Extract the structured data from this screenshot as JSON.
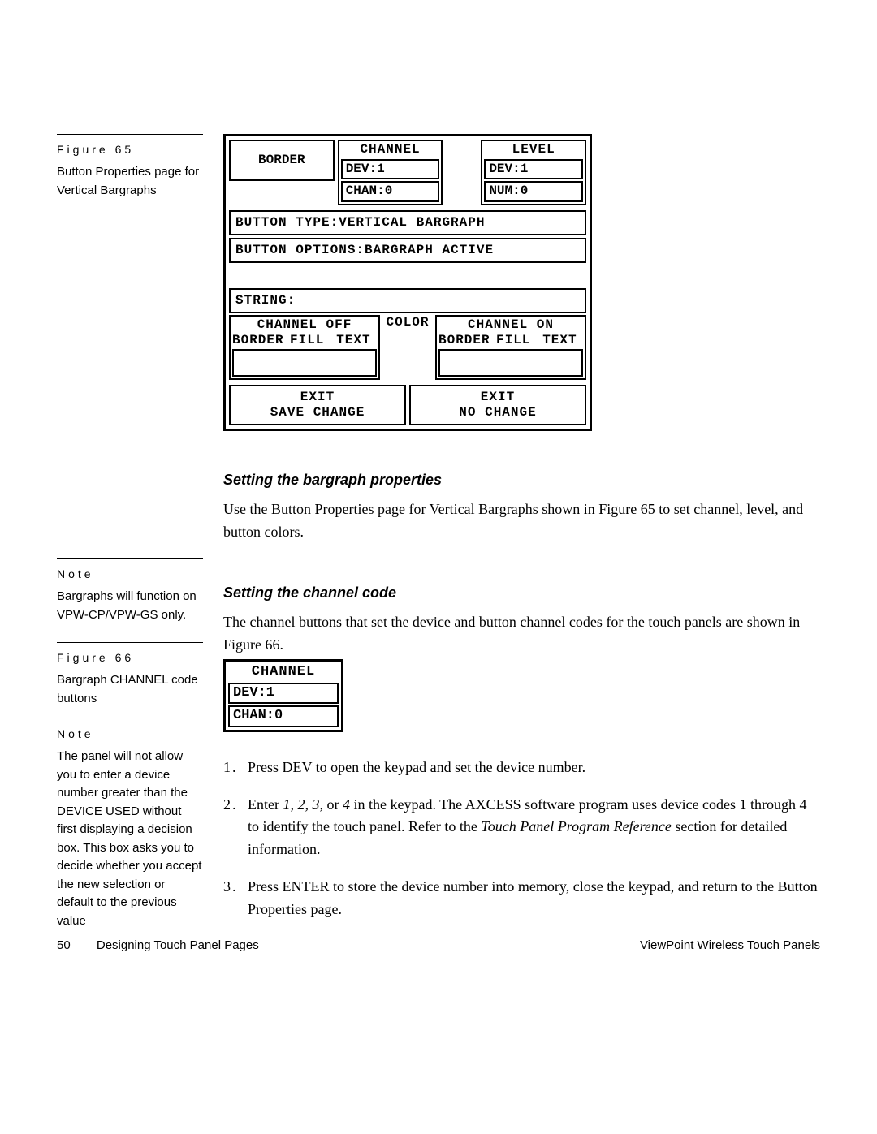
{
  "sidebar": {
    "fig65": {
      "label": "Figure 65",
      "caption": "Button Properties page for Vertical Bargraphs"
    },
    "note1": {
      "label": "Note",
      "text": "Bargraphs will function on VPW-CP/VPW-GS only."
    },
    "fig66": {
      "label": "Figure 66",
      "caption": "Bargraph CHANNEL code buttons"
    },
    "note2": {
      "label": "Note",
      "text": "The panel will not allow you to enter a device number greater than the DEVICE USED without first displaying a decision box. This box asks you to decide whether you accept the new selection or default to the previous value"
    }
  },
  "panel": {
    "border_label": "BORDER",
    "channel": {
      "title": "CHANNEL",
      "dev": "DEV:1",
      "chan": "CHAN:0"
    },
    "level": {
      "title": "LEVEL",
      "dev": "DEV:1",
      "num": "NUM:0"
    },
    "button_type": "BUTTON TYPE:VERTICAL BARGRAPH",
    "button_options": "BUTTON OPTIONS:BARGRAPH ACTIVE",
    "string": "STRING:",
    "color_label": "COLOR",
    "channel_off": {
      "title": "CHANNEL OFF",
      "c1": "BORDER",
      "c2": "FILL",
      "c3": "TEXT"
    },
    "channel_on": {
      "title": "CHANNEL ON",
      "c1": "BORDER",
      "c2": "FILL",
      "c3": "TEXT"
    },
    "exit_save": {
      "l1": "EXIT",
      "l2": "SAVE CHANGE"
    },
    "exit_nosave": {
      "l1": "EXIT",
      "l2": "NO CHANGE"
    }
  },
  "section1": {
    "heading": "Setting the bargraph properties",
    "p": "Use the Button Properties page for Vertical Bargraphs shown in Figure 65 to set channel, level, and button colors."
  },
  "section2": {
    "heading": "Setting the channel code",
    "p": "The channel buttons that set the device and button channel codes for the touch panels are shown in Figure 66."
  },
  "small_panel": {
    "title": "CHANNEL",
    "dev": "DEV:1",
    "chan": "CHAN:0"
  },
  "steps": {
    "s1": "Press DEV to open the keypad and set the device number.",
    "s2a": "Enter ",
    "s2b": "1, 2, 3,",
    "s2c": " or ",
    "s2d": "4",
    "s2e": " in the keypad. The AXCESS software program uses device codes 1 through 4 to identify the touch panel. Refer to the ",
    "s2f": "Touch Panel Program Reference",
    "s2g": " section for detailed information.",
    "s3": "Press ENTER to store the device number into memory, close the keypad, and return to the Button Properties page."
  },
  "footer": {
    "page": "50",
    "left": "Designing Touch Panel Pages",
    "right": "ViewPoint Wireless Touch Panels"
  }
}
